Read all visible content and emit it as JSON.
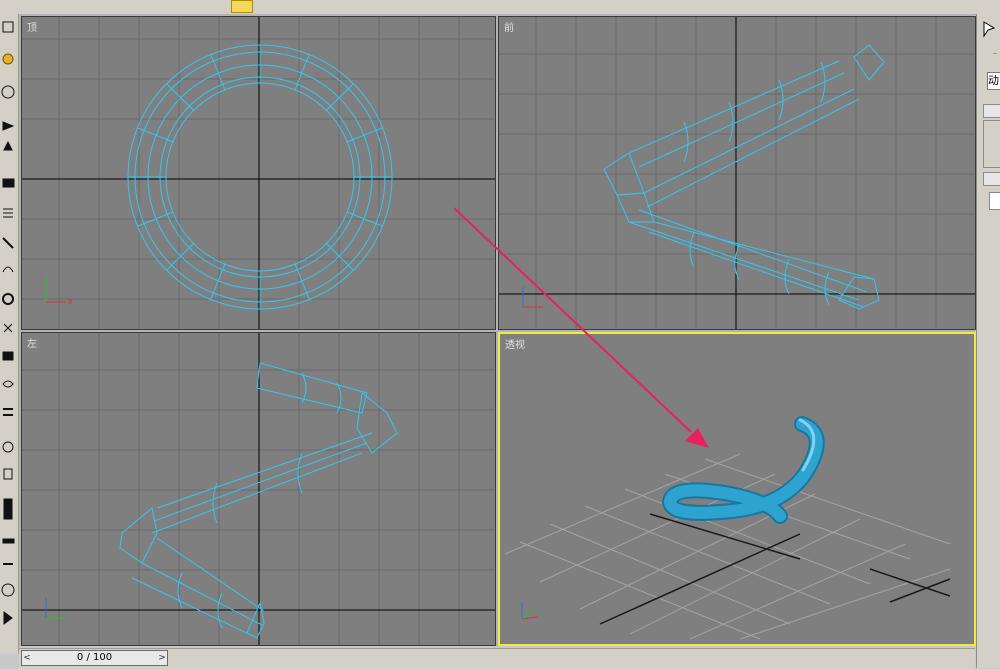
{
  "viewports": {
    "top": {
      "label": "顶"
    },
    "front": {
      "label": "前"
    },
    "left": {
      "label": "左"
    },
    "perspective": {
      "label": "透视"
    }
  },
  "axis": {
    "x": "x",
    "y": "y",
    "z": "z"
  },
  "time_slider": {
    "left_arrow": "<",
    "position_text": "0 / 100",
    "right_arrow": ">"
  },
  "right_panel": {
    "tab_label": "动"
  },
  "colors": {
    "viewport_bg": "#7f7f7f",
    "wireframe": "#33c6f2",
    "active_border": "#f2ea43",
    "annotation_arrow": "#e8205f",
    "solid_object": "#2ea3cf"
  }
}
